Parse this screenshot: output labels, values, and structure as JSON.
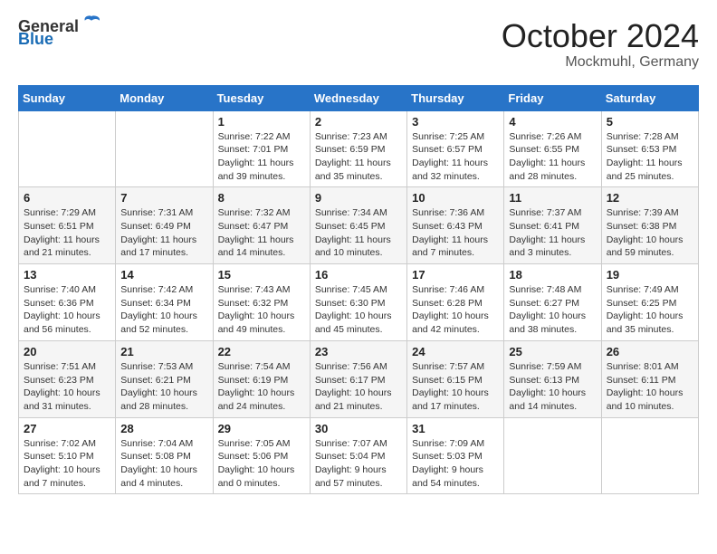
{
  "header": {
    "logo_general": "General",
    "logo_blue": "Blue",
    "month_title": "October 2024",
    "location": "Mockmuhl, Germany"
  },
  "days_of_week": [
    "Sunday",
    "Monday",
    "Tuesday",
    "Wednesday",
    "Thursday",
    "Friday",
    "Saturday"
  ],
  "weeks": [
    [
      {
        "day": "",
        "info": ""
      },
      {
        "day": "",
        "info": ""
      },
      {
        "day": "1",
        "info": "Sunrise: 7:22 AM\nSunset: 7:01 PM\nDaylight: 11 hours and 39 minutes."
      },
      {
        "day": "2",
        "info": "Sunrise: 7:23 AM\nSunset: 6:59 PM\nDaylight: 11 hours and 35 minutes."
      },
      {
        "day": "3",
        "info": "Sunrise: 7:25 AM\nSunset: 6:57 PM\nDaylight: 11 hours and 32 minutes."
      },
      {
        "day": "4",
        "info": "Sunrise: 7:26 AM\nSunset: 6:55 PM\nDaylight: 11 hours and 28 minutes."
      },
      {
        "day": "5",
        "info": "Sunrise: 7:28 AM\nSunset: 6:53 PM\nDaylight: 11 hours and 25 minutes."
      }
    ],
    [
      {
        "day": "6",
        "info": "Sunrise: 7:29 AM\nSunset: 6:51 PM\nDaylight: 11 hours and 21 minutes."
      },
      {
        "day": "7",
        "info": "Sunrise: 7:31 AM\nSunset: 6:49 PM\nDaylight: 11 hours and 17 minutes."
      },
      {
        "day": "8",
        "info": "Sunrise: 7:32 AM\nSunset: 6:47 PM\nDaylight: 11 hours and 14 minutes."
      },
      {
        "day": "9",
        "info": "Sunrise: 7:34 AM\nSunset: 6:45 PM\nDaylight: 11 hours and 10 minutes."
      },
      {
        "day": "10",
        "info": "Sunrise: 7:36 AM\nSunset: 6:43 PM\nDaylight: 11 hours and 7 minutes."
      },
      {
        "day": "11",
        "info": "Sunrise: 7:37 AM\nSunset: 6:41 PM\nDaylight: 11 hours and 3 minutes."
      },
      {
        "day": "12",
        "info": "Sunrise: 7:39 AM\nSunset: 6:38 PM\nDaylight: 10 hours and 59 minutes."
      }
    ],
    [
      {
        "day": "13",
        "info": "Sunrise: 7:40 AM\nSunset: 6:36 PM\nDaylight: 10 hours and 56 minutes."
      },
      {
        "day": "14",
        "info": "Sunrise: 7:42 AM\nSunset: 6:34 PM\nDaylight: 10 hours and 52 minutes."
      },
      {
        "day": "15",
        "info": "Sunrise: 7:43 AM\nSunset: 6:32 PM\nDaylight: 10 hours and 49 minutes."
      },
      {
        "day": "16",
        "info": "Sunrise: 7:45 AM\nSunset: 6:30 PM\nDaylight: 10 hours and 45 minutes."
      },
      {
        "day": "17",
        "info": "Sunrise: 7:46 AM\nSunset: 6:28 PM\nDaylight: 10 hours and 42 minutes."
      },
      {
        "day": "18",
        "info": "Sunrise: 7:48 AM\nSunset: 6:27 PM\nDaylight: 10 hours and 38 minutes."
      },
      {
        "day": "19",
        "info": "Sunrise: 7:49 AM\nSunset: 6:25 PM\nDaylight: 10 hours and 35 minutes."
      }
    ],
    [
      {
        "day": "20",
        "info": "Sunrise: 7:51 AM\nSunset: 6:23 PM\nDaylight: 10 hours and 31 minutes."
      },
      {
        "day": "21",
        "info": "Sunrise: 7:53 AM\nSunset: 6:21 PM\nDaylight: 10 hours and 28 minutes."
      },
      {
        "day": "22",
        "info": "Sunrise: 7:54 AM\nSunset: 6:19 PM\nDaylight: 10 hours and 24 minutes."
      },
      {
        "day": "23",
        "info": "Sunrise: 7:56 AM\nSunset: 6:17 PM\nDaylight: 10 hours and 21 minutes."
      },
      {
        "day": "24",
        "info": "Sunrise: 7:57 AM\nSunset: 6:15 PM\nDaylight: 10 hours and 17 minutes."
      },
      {
        "day": "25",
        "info": "Sunrise: 7:59 AM\nSunset: 6:13 PM\nDaylight: 10 hours and 14 minutes."
      },
      {
        "day": "26",
        "info": "Sunrise: 8:01 AM\nSunset: 6:11 PM\nDaylight: 10 hours and 10 minutes."
      }
    ],
    [
      {
        "day": "27",
        "info": "Sunrise: 7:02 AM\nSunset: 5:10 PM\nDaylight: 10 hours and 7 minutes."
      },
      {
        "day": "28",
        "info": "Sunrise: 7:04 AM\nSunset: 5:08 PM\nDaylight: 10 hours and 4 minutes."
      },
      {
        "day": "29",
        "info": "Sunrise: 7:05 AM\nSunset: 5:06 PM\nDaylight: 10 hours and 0 minutes."
      },
      {
        "day": "30",
        "info": "Sunrise: 7:07 AM\nSunset: 5:04 PM\nDaylight: 9 hours and 57 minutes."
      },
      {
        "day": "31",
        "info": "Sunrise: 7:09 AM\nSunset: 5:03 PM\nDaylight: 9 hours and 54 minutes."
      },
      {
        "day": "",
        "info": ""
      },
      {
        "day": "",
        "info": ""
      }
    ]
  ]
}
